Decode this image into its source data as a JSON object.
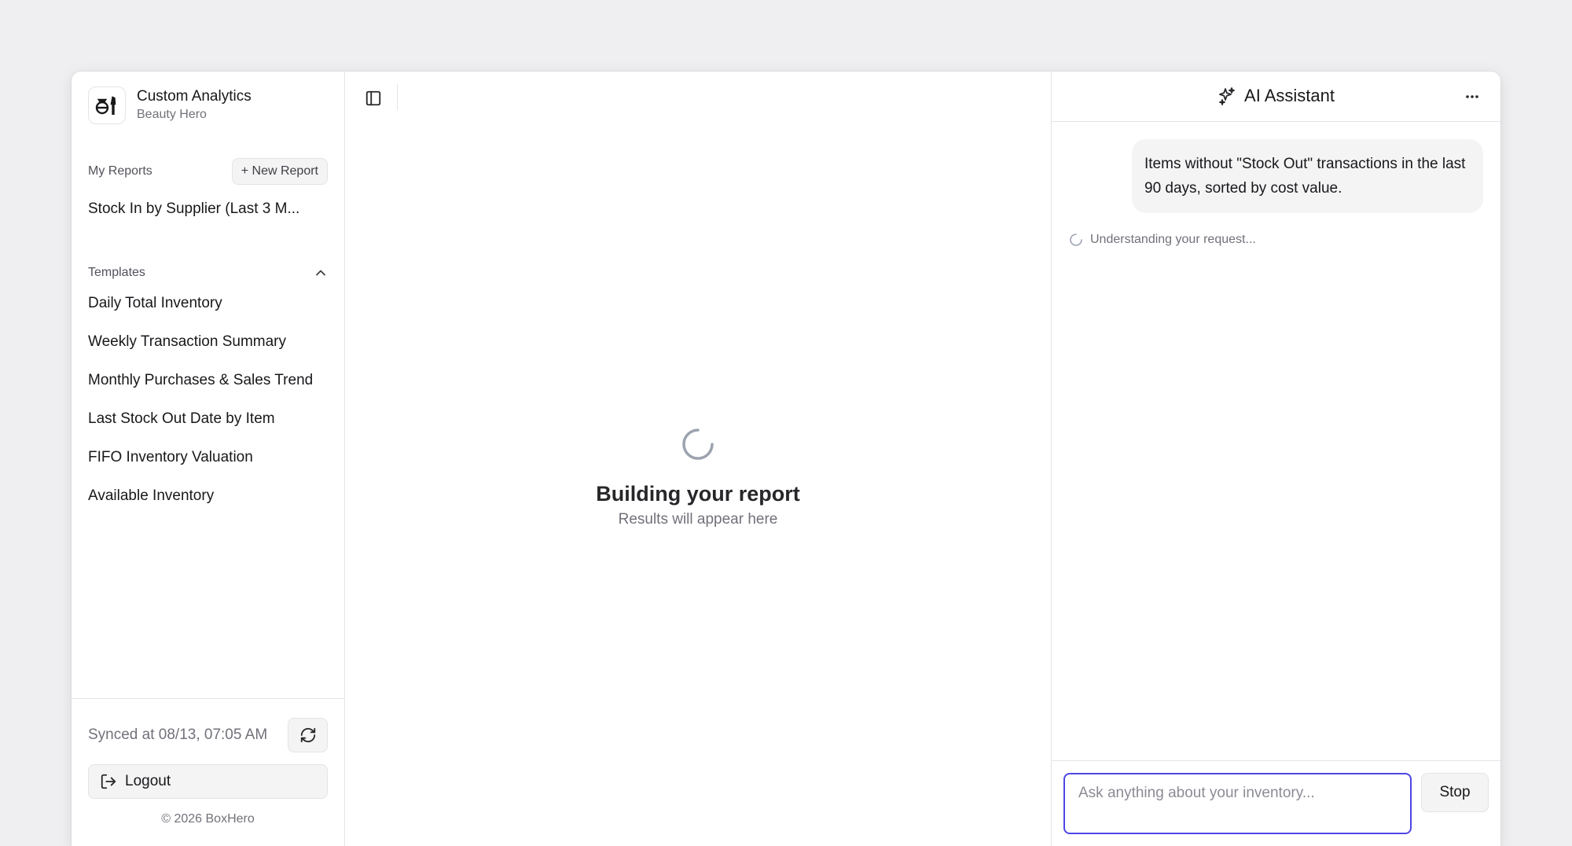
{
  "app": {
    "title": "Custom Analytics",
    "subtitle": "Beauty Hero"
  },
  "sidebar": {
    "my_reports_label": "My Reports",
    "new_report_label": "+ New Report",
    "reports": [
      {
        "label": "Stock In by Supplier (Last 3 M..."
      }
    ],
    "templates_label": "Templates",
    "templates_expanded": true,
    "templates": [
      {
        "label": "Daily Total Inventory"
      },
      {
        "label": "Weekly Transaction Summary"
      },
      {
        "label": "Monthly Purchases & Sales Trend"
      },
      {
        "label": "Last Stock Out Date by Item"
      },
      {
        "label": "FIFO Inventory Valuation"
      },
      {
        "label": "Available Inventory"
      }
    ],
    "sync_text": "Synced at 08/13, 07:05 AM",
    "logout_label": "Logout",
    "copyright": "© 2026 BoxHero"
  },
  "main": {
    "loading_title": "Building your report",
    "loading_subtitle": "Results will appear here"
  },
  "assistant": {
    "title": "AI Assistant",
    "messages": [
      {
        "role": "user",
        "text": "Items without \"Stock Out\" transactions in the last 90 days, sorted by cost value."
      }
    ],
    "status": "Understanding your request...",
    "input_placeholder": "Ask anything about your inventory...",
    "input_value": "",
    "stop_label": "Stop"
  },
  "colors": {
    "background": "#efeff1",
    "accent_focus": "#4f46e5",
    "muted_text": "#71717a",
    "border": "#e4e4e7"
  },
  "icons": {
    "brand": "makeup-logo-icon",
    "sidebar_toggle": "sidebar-toggle-icon",
    "templates_toggle": "chevron-up-icon",
    "sync": "refresh-icon",
    "logout": "logout-icon",
    "assistant": "sparkles-icon",
    "more": "more-horizontal-icon",
    "spinner": "spinner-icon"
  }
}
